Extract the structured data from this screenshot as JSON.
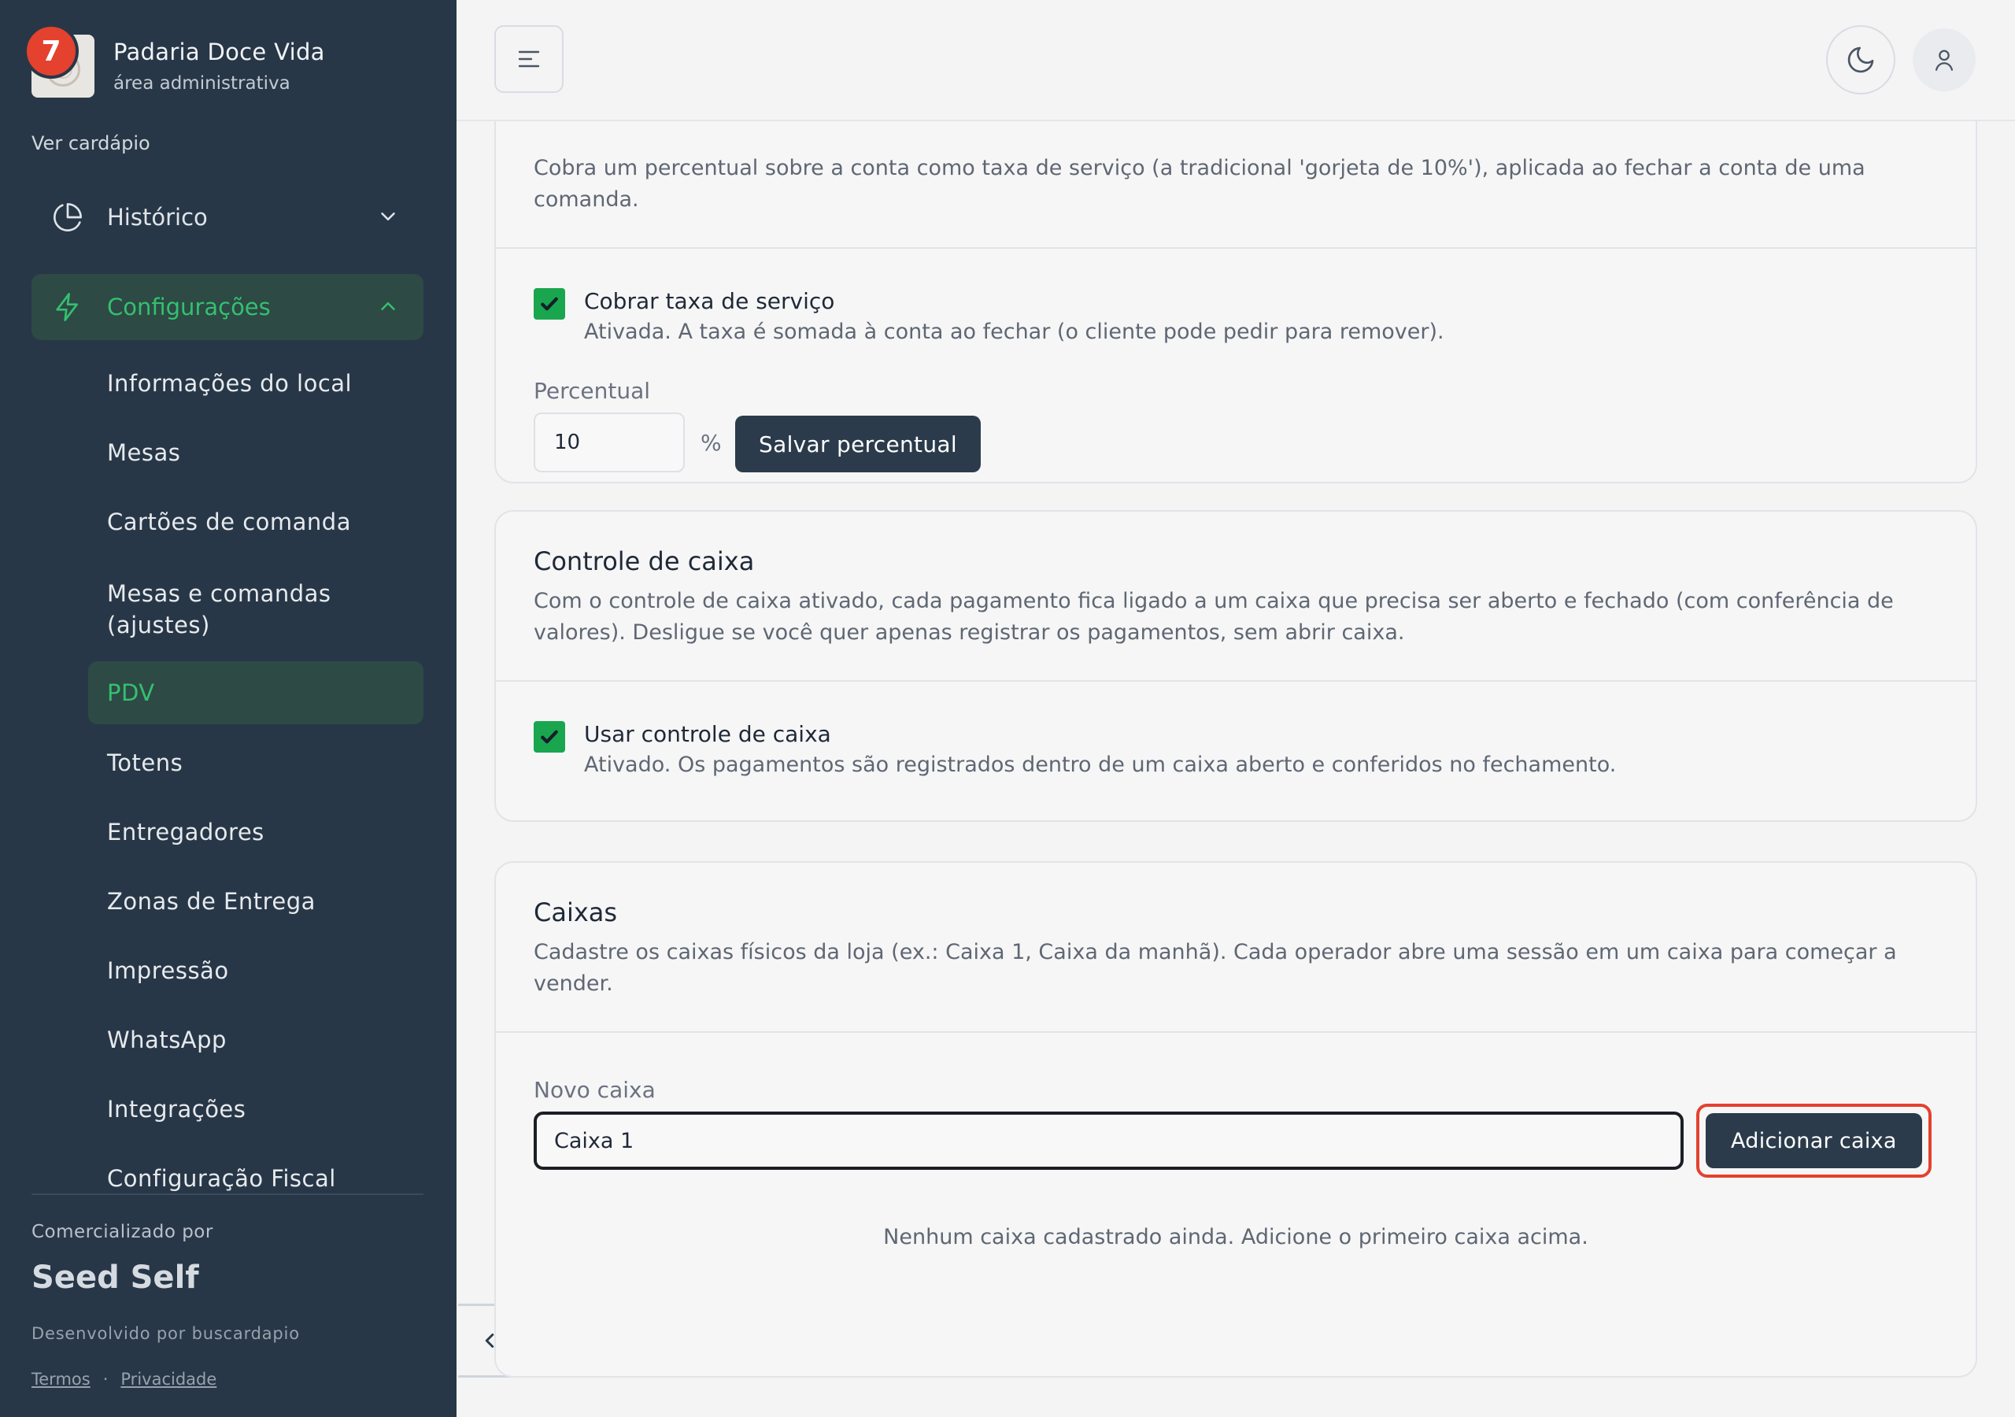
{
  "sidebar": {
    "brand_name": "Padaria Doce Vida",
    "brand_sub": "área administrativa",
    "notification_count": "7",
    "ver_cardapio": "Ver cardápio",
    "groups": [
      {
        "label": "Histórico",
        "icon": "pie-chart-icon",
        "expanded": false
      },
      {
        "label": "Configurações",
        "icon": "lightning-icon",
        "expanded": true
      }
    ],
    "items": [
      {
        "label": "Informações do local"
      },
      {
        "label": "Mesas"
      },
      {
        "label": "Cartões de comanda"
      },
      {
        "label": "Mesas e comandas (ajustes)"
      },
      {
        "label": "PDV",
        "active": true
      },
      {
        "label": "Totens"
      },
      {
        "label": "Entregadores"
      },
      {
        "label": "Zonas de Entrega"
      },
      {
        "label": "Impressão"
      },
      {
        "label": "WhatsApp"
      },
      {
        "label": "Integrações"
      },
      {
        "label": "Configuração Fiscal"
      }
    ],
    "footer": {
      "comercializado": "Comercializado por",
      "seed": "Seed Self",
      "desenvolvido": "Desenvolvido por buscardapio",
      "termos": "Termos",
      "separator": "·",
      "privacidade": "Privacidade"
    }
  },
  "header": {
    "menu_icon": "menu-icon",
    "theme_icon": "moon-icon",
    "user_icon": "user-icon"
  },
  "service_fee": {
    "description": "Cobra um percentual sobre a conta como taxa de serviço (a tradicional 'gorjeta de 10%'), aplicada ao fechar a conta de uma comanda.",
    "checkbox_title": "Cobrar taxa de serviço",
    "checkbox_desc": "Ativada. A taxa é somada à conta ao fechar (o cliente pode pedir para remover).",
    "checked": true,
    "percent_label": "Percentual",
    "percent_value": "10",
    "percent_sign": "%",
    "save_button": "Salvar percentual"
  },
  "cash_control": {
    "title": "Controle de caixa",
    "description": "Com o controle de caixa ativado, cada pagamento fica ligado a um caixa que precisa ser aberto e fechado (com conferência de valores). Desligue se você quer apenas registrar os pagamentos, sem abrir caixa.",
    "checkbox_title": "Usar controle de caixa",
    "checkbox_desc": "Ativado. Os pagamentos são registrados dentro de um caixa aberto e conferidos no fechamento.",
    "checked": true
  },
  "registers": {
    "title": "Caixas",
    "description": "Cadastre os caixas físicos da loja (ex.: Caixa 1, Caixa da manhã). Cada operador abre uma sessão em um caixa para começar a vender.",
    "new_label": "Novo caixa",
    "new_value": "Caixa 1",
    "add_button": "Adicionar caixa",
    "empty_message": "Nenhum caixa cadastrado ainda. Adicione o primeiro caixa acima."
  },
  "colors": {
    "sidebar_bg": "#283747",
    "accent_green": "#34c070",
    "active_bg": "#2d4a45",
    "checkbox_green": "#1aa64e",
    "dark_button": "#2b3b4b",
    "highlight_red": "#e4412f"
  }
}
